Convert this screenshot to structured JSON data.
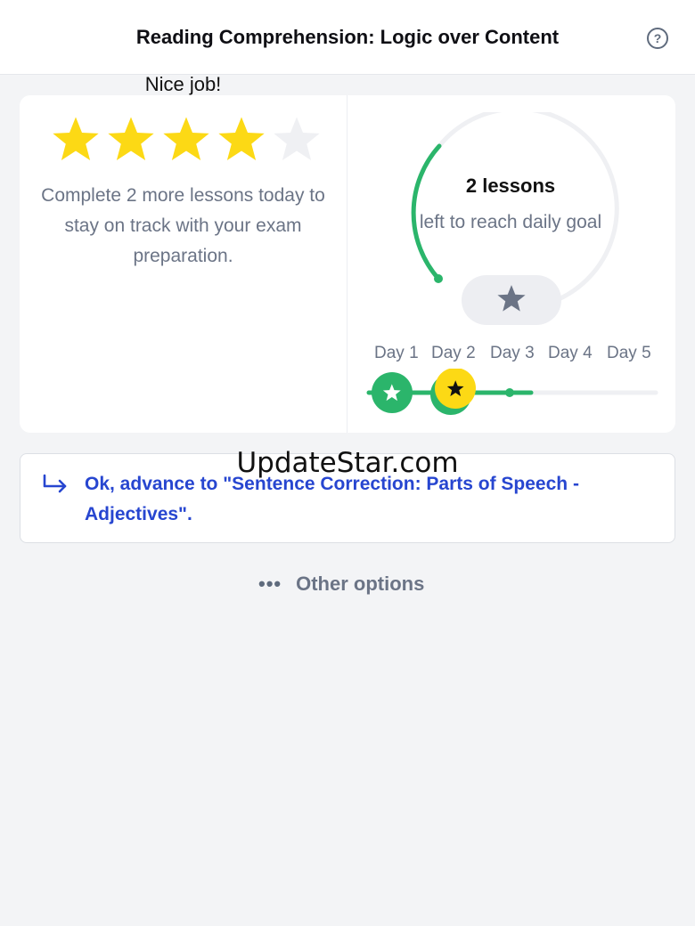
{
  "header": {
    "title": "Reading Comprehension: Logic over Content",
    "help_icon": "?"
  },
  "result": {
    "heading": "Nice job!",
    "rating": 4,
    "rating_max": 5,
    "summary": "Complete 2 more lessons today to stay on track with your exam preparation."
  },
  "goal": {
    "count_text": "2 lessons",
    "subtext": "left to reach daily goal",
    "days": [
      "Day 1",
      "Day 2",
      "Day 3",
      "Day 4",
      "Day 5"
    ]
  },
  "advance": {
    "label": "Ok, advance to \"Sentence Correction: Parts of Speech - Adjectives\"."
  },
  "other_options": {
    "dots": "•••",
    "label": "Other options"
  },
  "watermark": "UpdateStar.com",
  "colors": {
    "accent_green": "#2bb56b",
    "star_yellow": "#fcd915",
    "link_blue": "#2746d0"
  }
}
